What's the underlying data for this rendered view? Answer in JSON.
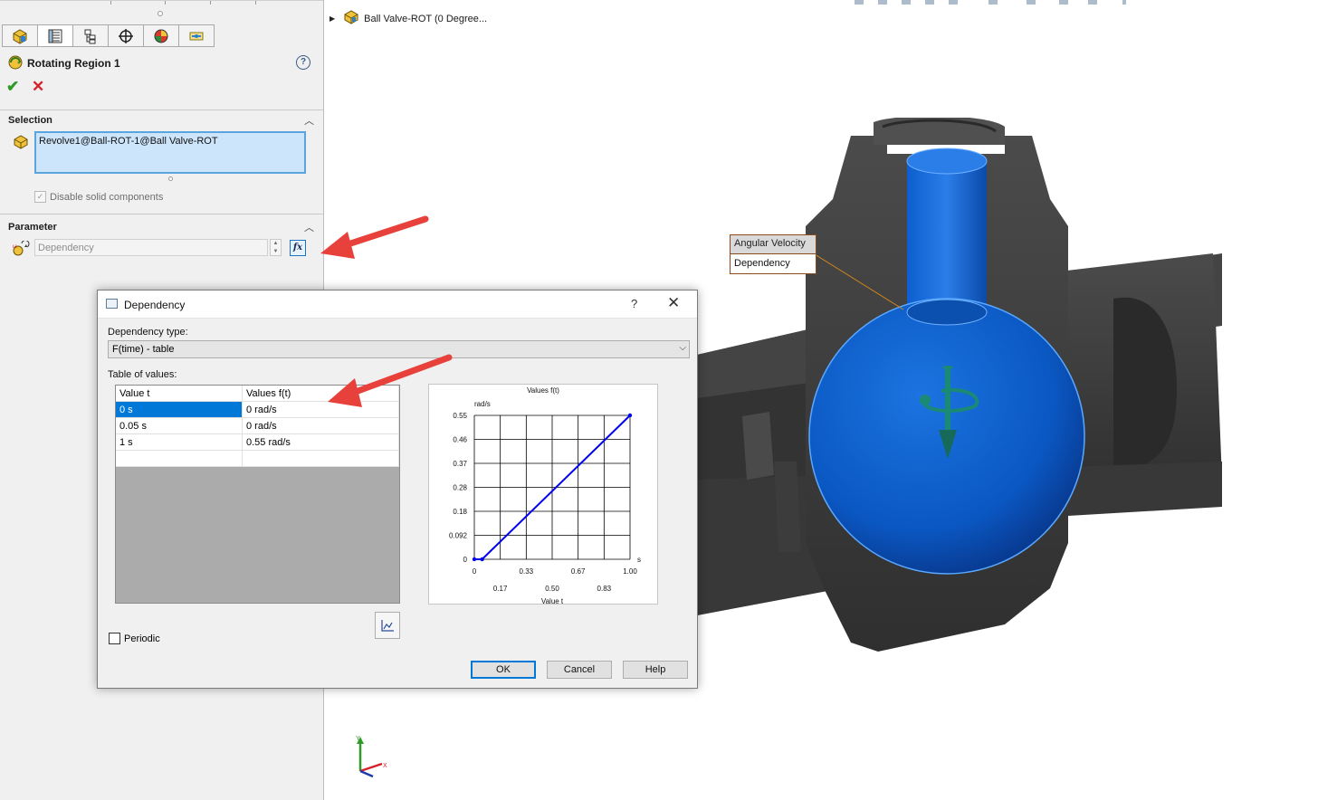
{
  "property_manager": {
    "title": "Rotating Region 1",
    "help_glyph": "?",
    "sections": {
      "selection": {
        "header": "Selection",
        "value": "Revolve1@Ball-ROT-1@Ball Valve-ROT",
        "checkbox_label": "Disable solid components",
        "checkbox_checked": true
      },
      "parameter": {
        "header": "Parameter",
        "input_value": "Dependency",
        "fx_label": "fx"
      }
    },
    "tabs": [
      "feature-manager-icon",
      "property-manager-icon",
      "configuration-manager-icon",
      "dimxpert-icon",
      "display-manager-icon",
      "flow-simulation-icon"
    ]
  },
  "tree": {
    "item_label": "Ball Valve-ROT  (0 Degree..."
  },
  "callout": {
    "title": "Angular Velocity",
    "value": "Dependency"
  },
  "dialog": {
    "title": "Dependency",
    "help_glyph": "?",
    "close_glyph": "✕",
    "dependency_type_label": "Dependency type:",
    "dependency_type_value": "F(time) - table",
    "table_label": "Table of values:",
    "columns": [
      "Value t",
      "Values f(t)"
    ],
    "rows": [
      [
        "0 s",
        "0 rad/s"
      ],
      [
        "0.05 s",
        "0 rad/s"
      ],
      [
        "1 s",
        "0.55 rad/s"
      ]
    ],
    "periodic_label": "Periodic",
    "periodic_checked": false,
    "buttons": {
      "ok": "OK",
      "cancel": "Cancel",
      "help": "Help"
    }
  },
  "chart_data": {
    "type": "line",
    "title": "Values f(t)",
    "xlabel": "Value t",
    "ylabel": "",
    "y_unit": "rad/s",
    "x_unit": "s",
    "x_ticks_upper": [
      "0",
      "0.33",
      "0.67",
      "1.00"
    ],
    "x_ticks_lower": [
      "0.17",
      "0.50",
      "0.83"
    ],
    "y_ticks": [
      "0.55",
      "0.46",
      "0.37",
      "0.28",
      "0.18",
      "0.092",
      "0"
    ],
    "xlim": [
      0,
      1
    ],
    "ylim": [
      0,
      0.55
    ],
    "grid": true,
    "series": [
      {
        "x": [
          0,
          0.05,
          1
        ],
        "y": [
          0,
          0,
          0.55
        ]
      }
    ],
    "line_color": "#0000ee"
  },
  "axis_triad": {
    "x": "X",
    "y": "Y"
  },
  "colors": {
    "accent": "#0078d7",
    "arrow_red": "#e8413b",
    "ball_blue": "#0a57c2",
    "body_dark": "#3a3a3a"
  }
}
